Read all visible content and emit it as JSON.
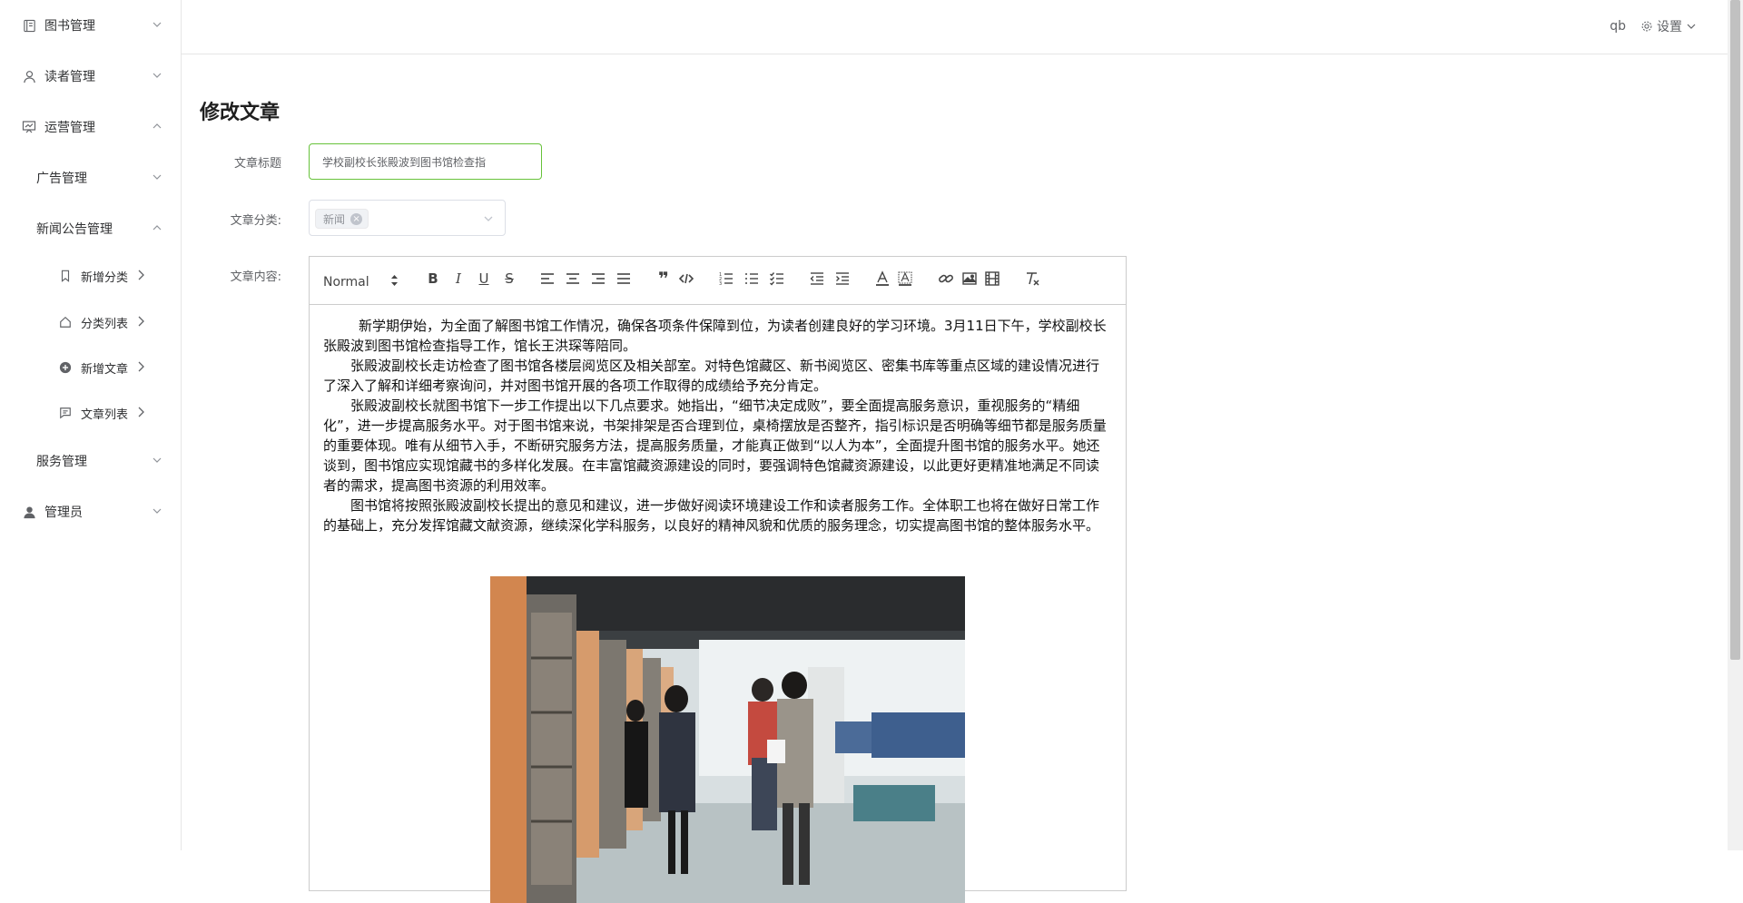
{
  "sidebar": {
    "items": [
      {
        "label": "图书管理"
      },
      {
        "label": "读者管理"
      },
      {
        "label": "运营管理"
      },
      {
        "label": "广告管理"
      },
      {
        "label": "新闻公告管理"
      },
      {
        "label": "新增分类"
      },
      {
        "label": "分类列表"
      },
      {
        "label": "新增文章"
      },
      {
        "label": "文章列表"
      },
      {
        "label": "服务管理"
      },
      {
        "label": "管理员"
      }
    ]
  },
  "header": {
    "user": "qb",
    "settings_label": "设置"
  },
  "form": {
    "page_title": "修改文章",
    "title_label": "文章标题",
    "title_value": "学校副校长张殿波到图书馆检查指",
    "category_label": "文章分类:",
    "category_tag": "新闻",
    "content_label": "文章内容:",
    "heading_select": "Normal"
  },
  "editor": {
    "paragraphs": [
      "新学期伊始，为全面了解图书馆工作情况，确保各项条件保障到位，为读者创建良好的学习环境。3月11日下午，学校副校长张殿波到图书馆检查指导工作，馆长王洪琛等陪同。",
      "张殿波副校长走访检查了图书馆各楼层阅览区及相关部室。对特色馆藏区、新书阅览区、密集书库等重点区域的建设情况进行了深入了解和详细考察询问，并对图书馆开展的各项工作取得的成绩给予充分肯定。",
      "张殿波副校长就图书馆下一步工作提出以下几点要求。她指出，“细节决定成败”，要全面提高服务意识，重视服务的“精细化”，进一步提高服务水平。对于图书馆来说，书架排架是否合理到位，桌椅摆放是否整齐，指引标识是否明确等细节都是服务质量的重要体现。唯有从细节入手，不断研究服务方法，提高服务质量，才能真正做到“以人为本”，全面提升图书馆的服务水平。她还谈到，图书馆应实现馆藏书的多样化发展。在丰富馆藏资源建设的同时，要强调特色馆藏资源建设，以此更好更精准地满足不同读者的需求，提高图书资源的利用效率。",
      "图书馆将按照张殿波副校长提出的意见和建议，进一步做好阅读环境建设工作和读者服务工作。全体职工也将在做好日常工作的基础上，充分发挥馆藏文献资源，继续深化学科服务，以良好的精神风貌和优质的服务理念，切实提高图书馆的整体服务水平。"
    ]
  },
  "colors": {
    "accent_green": "#67c23a",
    "border": "#dcdfe6",
    "text": "#303133"
  }
}
